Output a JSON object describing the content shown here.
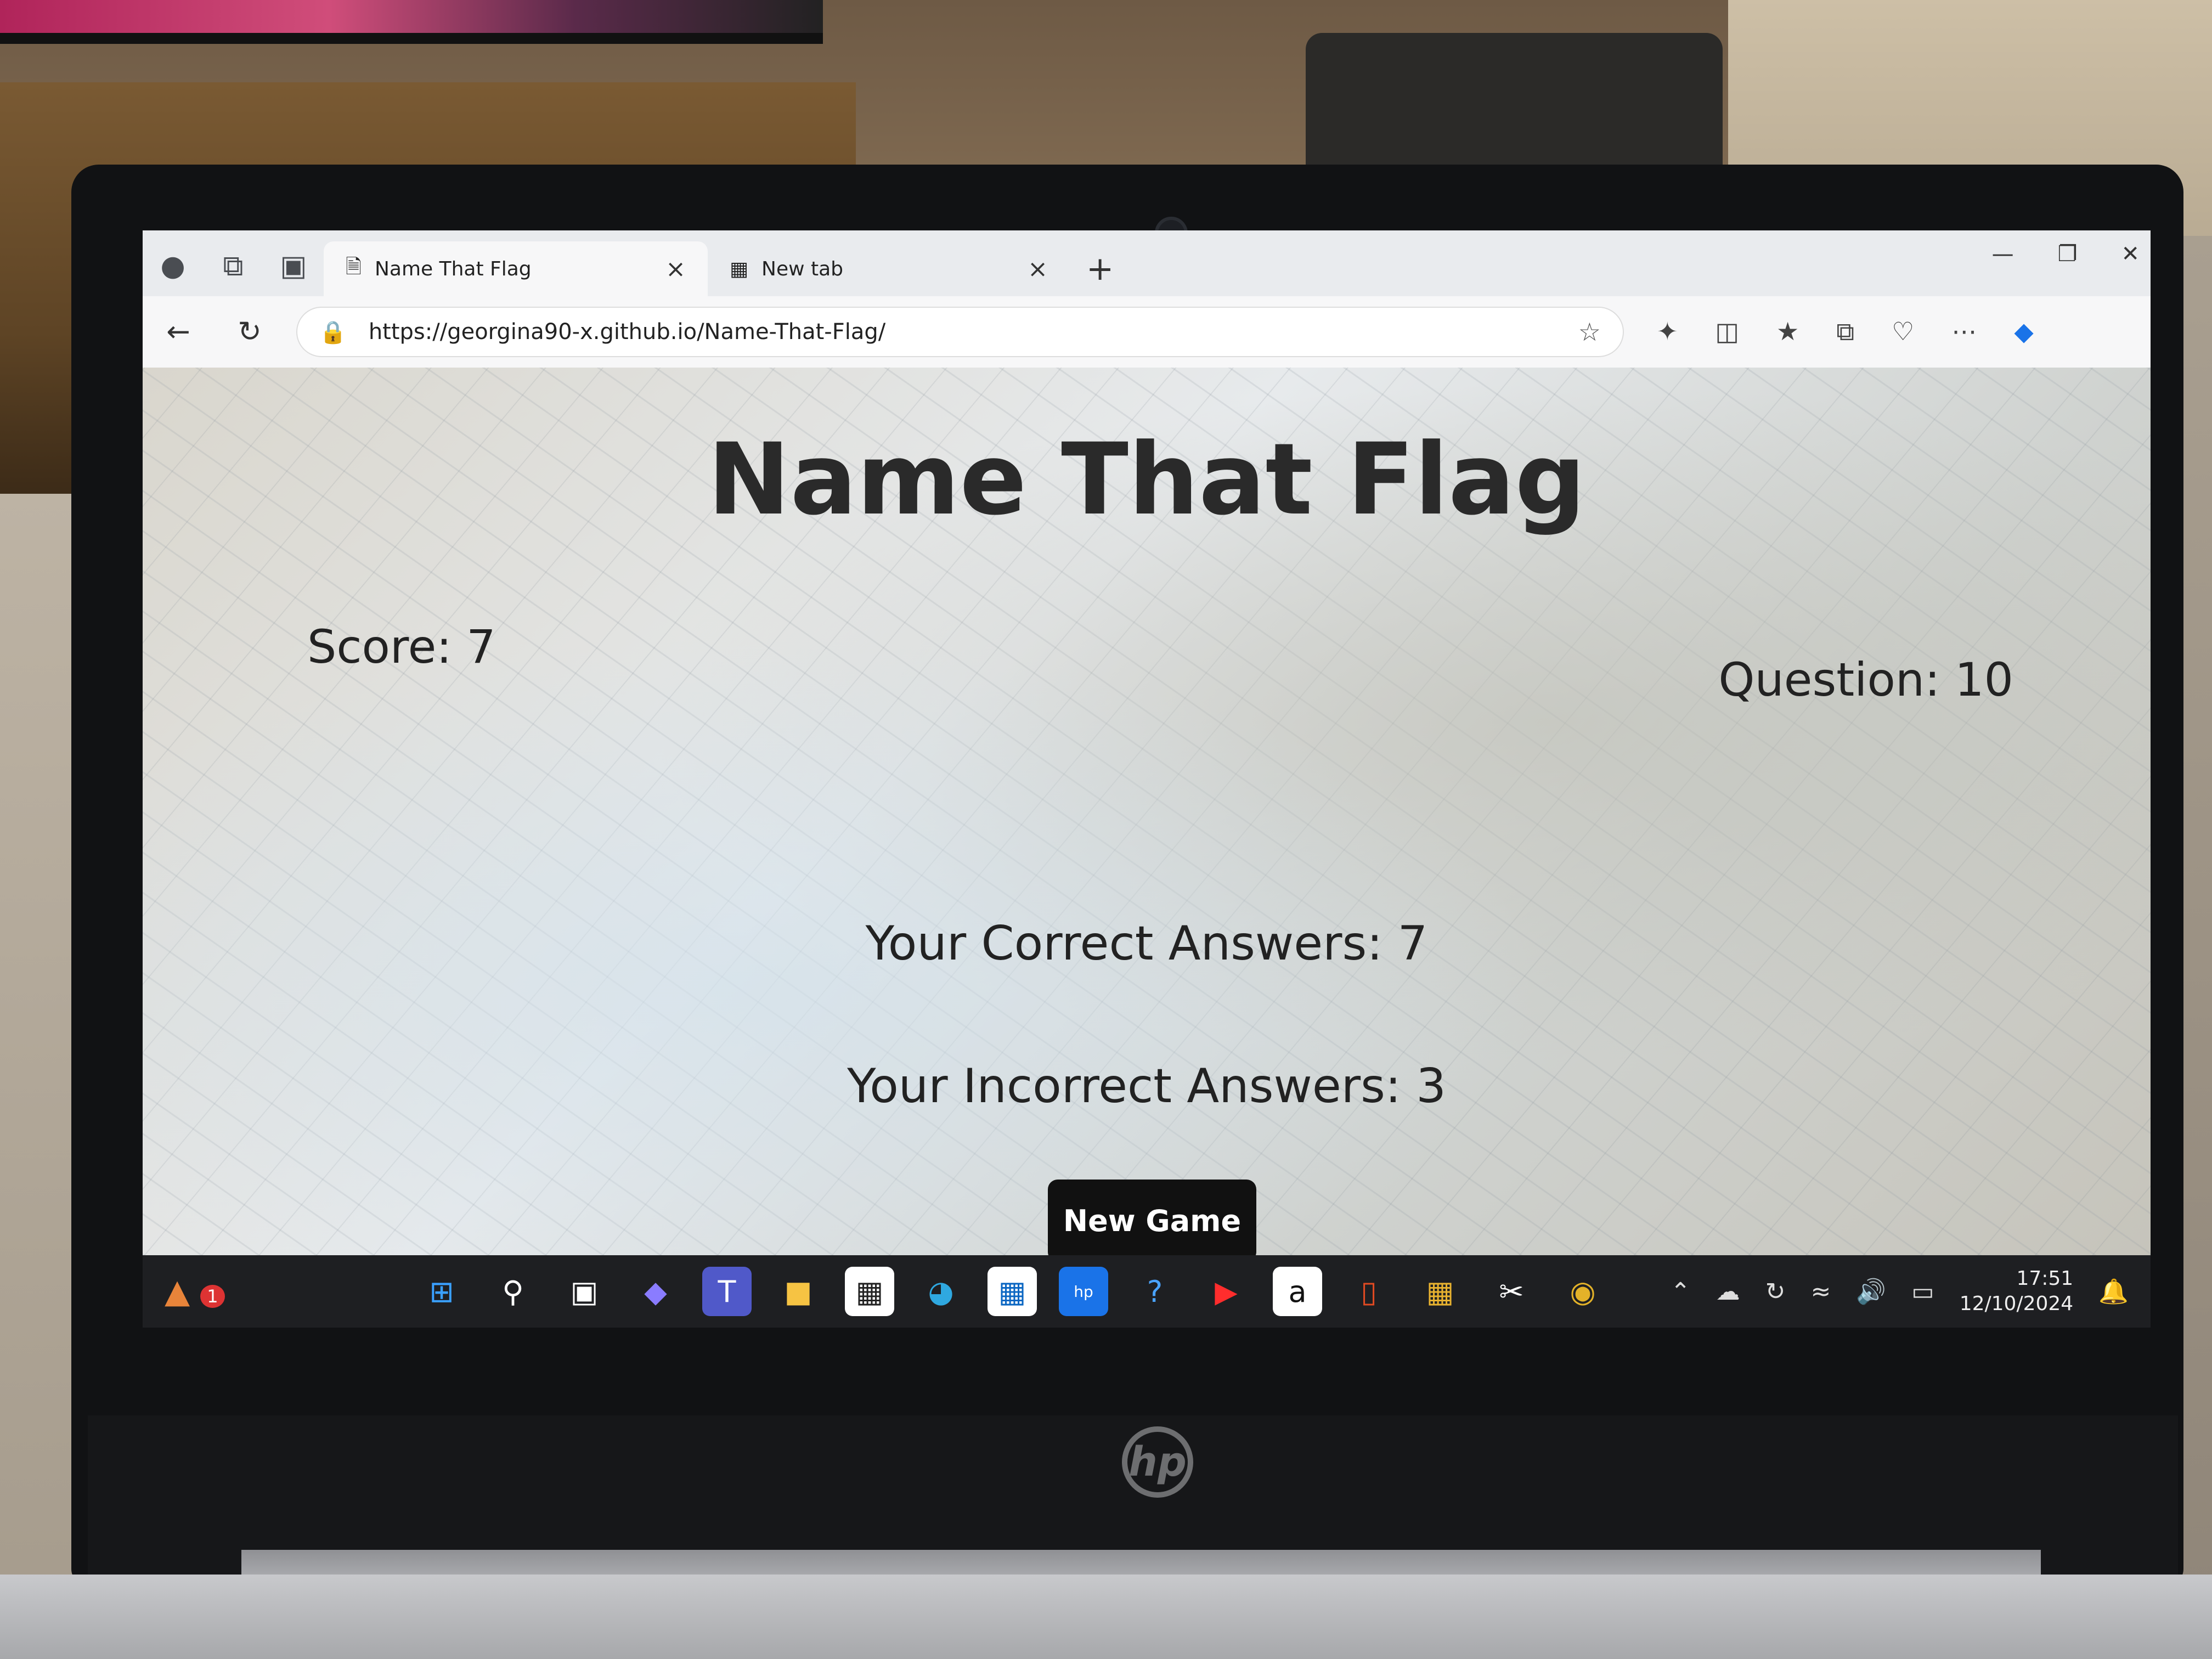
{
  "browser": {
    "tabs": [
      {
        "label": "Name That Flag",
        "active": true
      },
      {
        "label": "New tab",
        "active": false
      }
    ],
    "close_symbol": "×",
    "new_tab_symbol": "+",
    "url": "https://georgina90-x.github.io/Name-That-Flag/",
    "window_controls": [
      "—",
      "❐",
      "✕"
    ],
    "icons": {
      "profile": "profile-icon",
      "workspaces": "workspaces-icon",
      "tab-actions": "tab-actions-icon",
      "back": "back-arrow-icon",
      "refresh": "refresh-icon",
      "lock": "lock-icon",
      "favorite": "star-icon",
      "extensions": "extensions-icon",
      "split-screen": "split-screen-icon",
      "favorites": "favorites-icon",
      "collections": "collections-icon",
      "browser-essentials": "browser-essentials-icon",
      "more": "more-icon",
      "copilot": "copilot-icon"
    }
  },
  "game": {
    "title": "Name That Flag",
    "score_label": "Score: 7",
    "question_label": "Question: 10",
    "correct_label": "Your Correct Answers: 7",
    "incorrect_label": "Your Incorrect Answers: 3",
    "new_game_label": "New Game"
  },
  "taskbar": {
    "badge_count": "1",
    "apps": [
      "windows-start-icon",
      "search-icon",
      "task-view-icon",
      "copilot-icon",
      "teams-icon",
      "file-explorer-icon",
      "widgets-icon",
      "edge-icon",
      "store-icon",
      "myhp-icon",
      "help-icon",
      "youtube-icon",
      "amazon-icon",
      "office-icon",
      "app-icon",
      "snipping-tool-icon",
      "chrome-icon"
    ],
    "tray": [
      "chevron-up-icon",
      "onedrive-icon",
      "sync-icon",
      "wifi-icon",
      "volume-icon",
      "battery-icon"
    ],
    "time": "17:51",
    "date": "12/10/2024",
    "notification": "bell-icon"
  },
  "laptop": {
    "brand_logo": "hp"
  },
  "colors": {
    "button_bg": "#111111",
    "button_text": "#ffffff",
    "text": "#222222",
    "edge_blue": "#1a73e8"
  }
}
